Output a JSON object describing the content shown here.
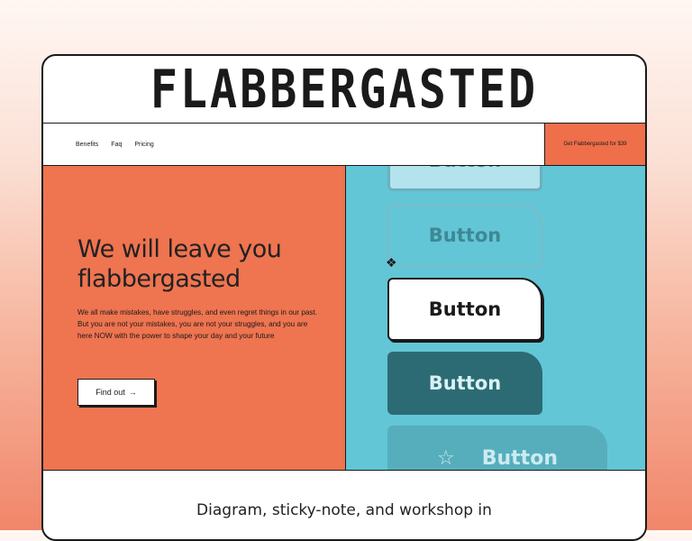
{
  "brand": "FLABBERGASTED",
  "nav": {
    "links": [
      "Benefits",
      "Faq",
      "Pricing"
    ],
    "cta": "Get Flabbergasted for $39"
  },
  "hero": {
    "headline": "We will leave you flabbergasted",
    "body": "We all make mistakes, have struggles, and even regret things in our past. But you are not your mistakes, you are not your struggles, and you are here NOW with the power to shape your day and your future",
    "cta_label": "Find out",
    "cta_arrow": "→"
  },
  "showcase": {
    "buttons": [
      "Button",
      "Button",
      "Button",
      "Button",
      "Button"
    ],
    "star_glyph": "☆",
    "cursor_glyph": "❖"
  },
  "footer": {
    "text": "Diagram, sticky-note, and workshop in"
  },
  "colors": {
    "orange": "#ef7450",
    "teal": "#62c6d6",
    "dark_teal": "#2d6b74"
  }
}
